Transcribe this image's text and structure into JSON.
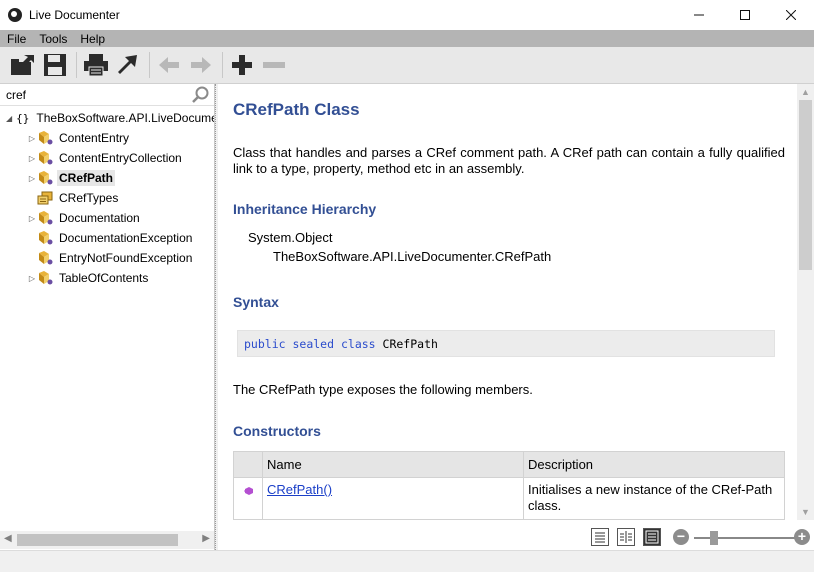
{
  "window": {
    "title": "Live Documenter",
    "controls": [
      "minimize-icon",
      "maximize-icon",
      "close-icon"
    ]
  },
  "menu": {
    "file": "File",
    "tools": "Tools",
    "help": "Help"
  },
  "toolbar": {
    "buttons": [
      "open-icon",
      "save-icon",
      "print-icon",
      "export-icon",
      "back-icon",
      "forward-icon",
      "add-icon",
      "remove-icon"
    ]
  },
  "search": {
    "value": "cref"
  },
  "tree": {
    "root": "TheBoxSoftware.API.LiveDocumenter",
    "items": [
      {
        "label": "ContentEntry",
        "expandable": true
      },
      {
        "label": "ContentEntryCollection",
        "expandable": true
      },
      {
        "label": "CRefPath",
        "expandable": true,
        "selected": true
      },
      {
        "label": "CRefTypes",
        "expandable": false,
        "icon": "enum-icon"
      },
      {
        "label": "Documentation",
        "expandable": true
      },
      {
        "label": "DocumentationException",
        "expandable": false
      },
      {
        "label": "EntryNotFoundException",
        "expandable": false
      },
      {
        "label": "TableOfContents",
        "expandable": true
      }
    ]
  },
  "doc": {
    "title": "CRefPath Class",
    "summary": "Class that handles and parses a CRef comment path. A CRef path can contain a fully qualified link to a type, property, method etc in an assembly.",
    "inheritance_heading": "Inheritance Hierarchy",
    "inheritance": [
      "System.Object",
      "TheBoxSoftware.API.LiveDocumenter.CRefPath"
    ],
    "syntax_heading": "Syntax",
    "syntax": {
      "kw1": "public",
      "kw2": "sealed",
      "kw3": "class",
      "name": "CRefPath"
    },
    "members_line": "The CRefPath type exposes the following members.",
    "constructors_heading": "Constructors",
    "table": {
      "col_name": "Name",
      "col_desc": "Description",
      "rows": [
        {
          "name": "CRefPath()",
          "description": "Initialises a new instance of the CRef-Path class."
        }
      ]
    }
  },
  "colors": {
    "heading": "#324f94",
    "link": "#1b3fc8",
    "keyword": "#2b4ccc",
    "menubar": "#b4b4b4"
  }
}
